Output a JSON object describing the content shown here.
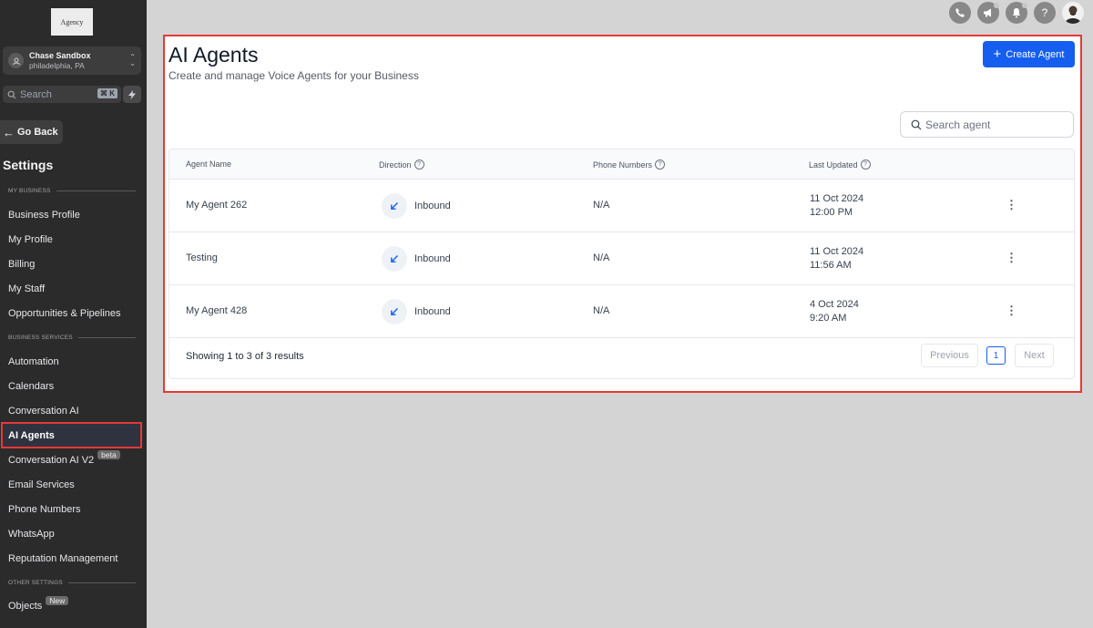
{
  "sidebar": {
    "logo_text": "Agency",
    "account": {
      "name": "Chase Sandbox",
      "location": "philadelphia, PA"
    },
    "search": {
      "placeholder": "Search",
      "shortcut": "⌘ K"
    },
    "go_back": "Go Back",
    "title": "Settings",
    "sections": {
      "my_business": "MY BUSINESS",
      "business_services": "BUSINESS SERVICES",
      "other_settings": "OTHER SETTINGS"
    },
    "items": [
      {
        "label": "Business Profile"
      },
      {
        "label": "My Profile"
      },
      {
        "label": "Billing"
      },
      {
        "label": "My Staff"
      },
      {
        "label": "Opportunities & Pipelines"
      },
      {
        "label": "Automation"
      },
      {
        "label": "Calendars"
      },
      {
        "label": "Conversation AI"
      },
      {
        "label": "AI Agents",
        "active": true
      },
      {
        "label": "Conversation AI V2",
        "badge": "beta"
      },
      {
        "label": "Email Services"
      },
      {
        "label": "Phone Numbers"
      },
      {
        "label": "WhatsApp"
      },
      {
        "label": "Reputation Management"
      },
      {
        "label": "Objects",
        "badge": "New"
      }
    ]
  },
  "topbar": {
    "icons": [
      "phone-icon",
      "megaphone-icon",
      "bell-icon",
      "help-icon"
    ],
    "help_glyph": "?"
  },
  "main": {
    "title": "AI Agents",
    "subtitle": "Create and manage Voice Agents for your Business",
    "create_button": "Create Agent",
    "search_placeholder": "Search agent",
    "table": {
      "columns": [
        "Agent Name",
        "Direction",
        "Phone Numbers",
        "Last Updated"
      ],
      "rows": [
        {
          "name": "My Agent 262",
          "direction": "Inbound",
          "phone": "N/A",
          "date": "11 Oct 2024",
          "time": "12:00 PM"
        },
        {
          "name": "Testing",
          "direction": "Inbound",
          "phone": "N/A",
          "date": "11 Oct 2024",
          "time": "11:56 AM"
        },
        {
          "name": "My Agent 428",
          "direction": "Inbound",
          "phone": "N/A",
          "date": "4 Oct 2024",
          "time": "9:20 AM"
        }
      ],
      "footer": "Showing 1 to 3 of 3 results",
      "pagination": {
        "previous": "Previous",
        "page": "1",
        "next": "Next"
      }
    }
  },
  "colors": {
    "accent": "#155eef",
    "highlight": "#e53935",
    "sidebar_bg": "#2b2b2b"
  }
}
